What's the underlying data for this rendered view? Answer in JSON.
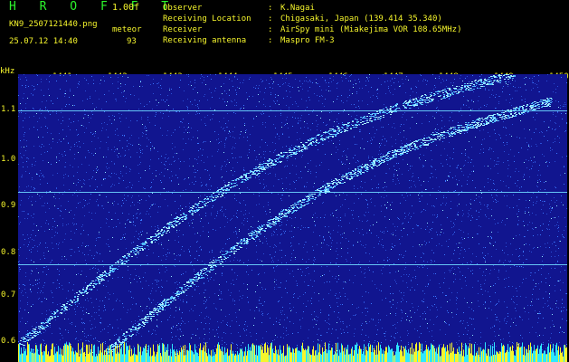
{
  "header": {
    "app_title": "H R O F F T",
    "version": "1.00f",
    "filename": "KN9_2507121440.png",
    "meteor_label": "meteor",
    "datetime": "25.07.12 14:40",
    "meteor_count": "93"
  },
  "info": [
    {
      "key": "Observer",
      "value": "K.Nagai"
    },
    {
      "key": "Receiving Location",
      "value": "Chigasaki, Japan (139.414 35.340)"
    },
    {
      "key": "Receiver",
      "value": "AirSpy mini (Miakejima VOR 108.65MHz)"
    },
    {
      "key": "Receiving antenna",
      "value": "Maspro FM-3"
    }
  ],
  "plot": {
    "unit": "kHz",
    "y_ticks": [
      "1.1",
      "1.0",
      "0.9",
      "0.8",
      "0.7",
      "0.6"
    ],
    "x_ticks": [
      "1441",
      "1442",
      "1443",
      "1444",
      "1445",
      "1446",
      "1447",
      "1448",
      "1449",
      "1450"
    ],
    "colors": {
      "background": "#11158f",
      "noise": "#3a78ff",
      "trace": "#6fd8ff",
      "text": "#f5f52c"
    }
  }
}
